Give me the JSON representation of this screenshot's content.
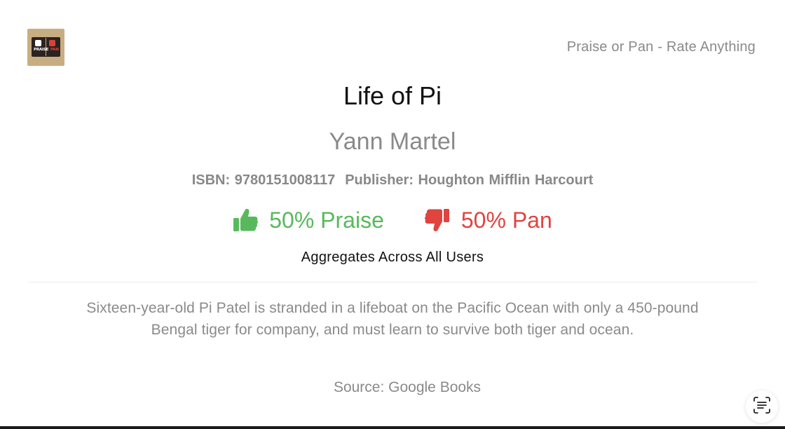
{
  "header": {
    "logo": {
      "icon": "praise-or-pan-logo",
      "word_praise": "PRAISE",
      "word_pan": "PAN"
    },
    "tagline": "Praise or Pan - Rate Anything"
  },
  "book": {
    "title": "Life of Pi",
    "author": "Yann Martel",
    "isbn_label": "ISBN: 9780151008117",
    "publisher_label": "Publisher: Houghton Mifflin Harcourt",
    "description_line1": "Sixteen-year-old Pi Patel is stranded in a lifeboat on the Pacific Ocean with only a 450-pound",
    "description_line2": "Bengal tiger for company, and must learn to survive both tiger and ocean.",
    "source": "Source: Google Books"
  },
  "ratings": {
    "praise": {
      "icon": "thumbs-up-icon",
      "label": "50% Praise",
      "percent": 50,
      "color": "#58b95c"
    },
    "pan": {
      "icon": "thumbs-down-icon",
      "label": "50% Pan",
      "percent": 50,
      "color": "#e0443f"
    },
    "caption": "Aggregates Across All Users"
  },
  "floating_action": {
    "icon": "text-scan-icon"
  }
}
